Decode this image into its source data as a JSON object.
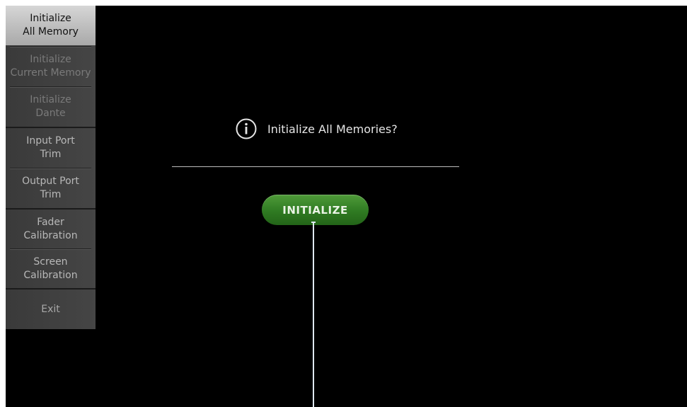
{
  "sidebar": {
    "items": [
      {
        "label": "Initialize\nAll Memory",
        "state": "active"
      },
      {
        "label": "Initialize\nCurrent Memory",
        "state": "disabled"
      },
      {
        "label": "Initialize\nDante",
        "state": "disabled"
      },
      {
        "label": "Input Port\nTrim",
        "state": "enabled"
      },
      {
        "label": "Output Port\nTrim",
        "state": "enabled"
      },
      {
        "label": "Fader\nCalibration",
        "state": "enabled"
      },
      {
        "label": "Screen\nCalibration",
        "state": "enabled"
      },
      {
        "label": "Exit",
        "state": "enabled"
      }
    ]
  },
  "dialog": {
    "icon": "info-icon",
    "message": "Initialize All Memories?"
  },
  "actions": {
    "initialize_label": "INITIALIZE"
  },
  "colors": {
    "background": "#000000",
    "active_item": "#c4c4c4",
    "button_green": "#3a8a2a",
    "callout": "#dfe9f2"
  }
}
